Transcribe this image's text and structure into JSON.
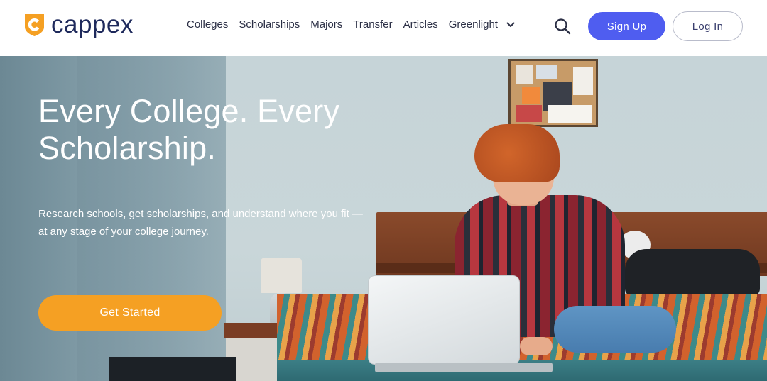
{
  "brand": {
    "name": "cappex",
    "color": "#1f2a5c",
    "mark_color": "#f5a023",
    "mark_icon": "shield-c-icon"
  },
  "nav": {
    "items": [
      {
        "label": "Colleges"
      },
      {
        "label": "Scholarships"
      },
      {
        "label": "Majors"
      },
      {
        "label": "Transfer"
      },
      {
        "label": "Articles"
      },
      {
        "label": "Greenlight",
        "dropdown": true,
        "icon": "chevron-down-icon"
      }
    ],
    "search_icon": "search-icon"
  },
  "auth": {
    "signup_label": "Sign Up",
    "signup_color": "#4f5df0",
    "login_label": "Log In"
  },
  "hero": {
    "title": "Every College. Every Scholarship.",
    "subtitle": "Research schools, get scholarships, and understand where you fit — at any stage of your college journey.",
    "cta_label": "Get Started",
    "cta_color": "#f5a023"
  }
}
